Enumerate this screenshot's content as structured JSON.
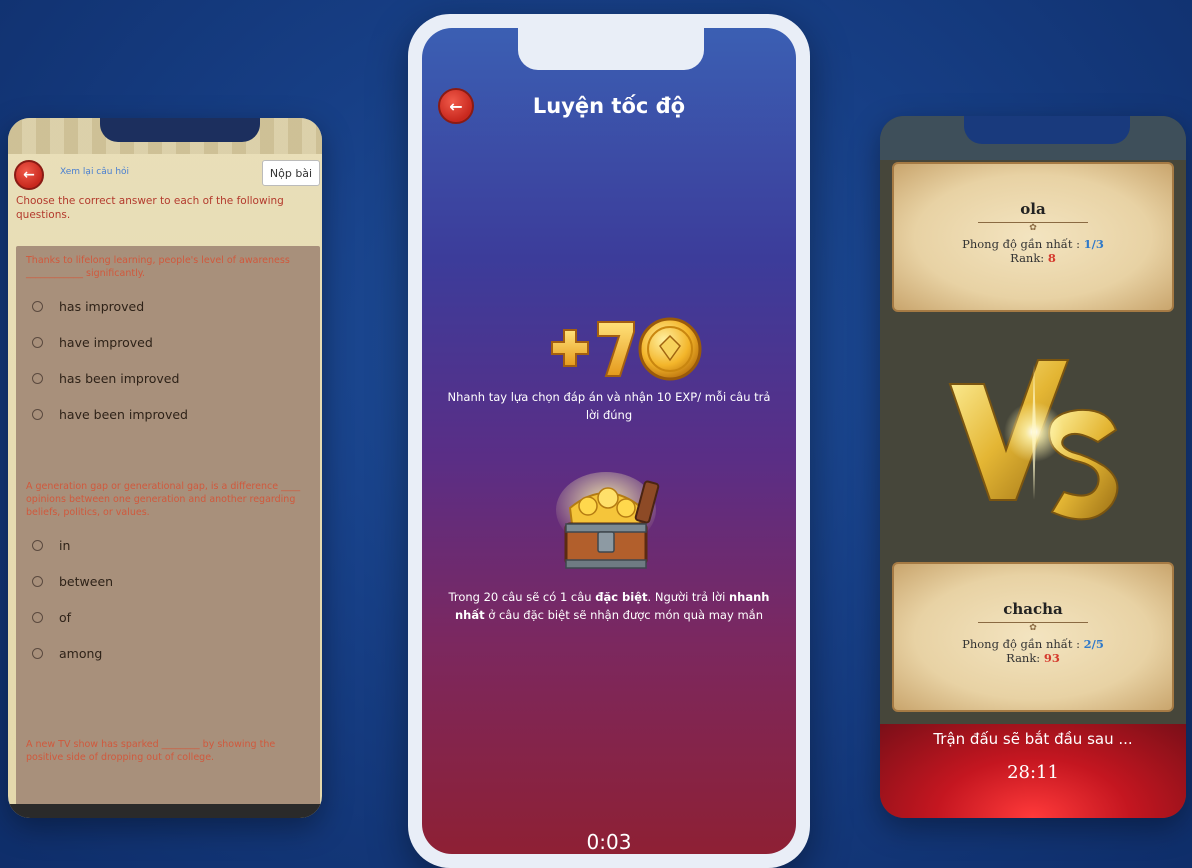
{
  "left_screen": {
    "review_link": "Xem lại câu hỏi",
    "submit_label": "Nộp bài",
    "instruction": "Choose the correct answer to each of the following questions.",
    "questions": [
      {
        "text": "Thanks to lifelong learning, people's level of awareness ____________ significantly.",
        "options": [
          "has improved",
          "have improved",
          "has been improved",
          "have been improved"
        ]
      },
      {
        "text": "A generation gap or generational gap, is a difference ____ opinions between one generation and another regarding beliefs, politics, or values.",
        "options": [
          "in",
          "between",
          "of",
          "among"
        ]
      },
      {
        "text": "A new TV show has sparked ________ by showing the positive side of dropping out of college."
      }
    ]
  },
  "center_screen": {
    "title": "Luyện tốc độ",
    "reward_line": "Nhanh tay lựa chọn đáp án và nhận 10 EXP/ mỗi câu trả lời đúng",
    "special_intro": "Trong 20 câu sẽ có 1 câu ",
    "special_bold1": "đặc biệt",
    "special_mid": ". Người trả lời ",
    "special_bold2": "nhanh nhất",
    "special_end": " ở câu đặc biệt sẽ nhận được món quà may mắn",
    "timer": "0:03"
  },
  "right_screen": {
    "players": [
      {
        "name": "ola",
        "form_label": "Phong độ gần nhất : ",
        "form_value": "1/3",
        "rank_label": "Rank: ",
        "rank_value": "8"
      },
      {
        "name": "chacha",
        "form_label": "Phong độ gần nhất : ",
        "form_value": "2/5",
        "rank_label": "Rank: ",
        "rank_value": "93"
      }
    ],
    "start_text": "Trận đấu sẽ bắt đầu sau ...",
    "countdown": "28:11"
  },
  "colors": {
    "background": "#173f86",
    "accent_red": "#c8281e",
    "form_blue": "#2f79c9",
    "rank_red": "#d53a2d"
  },
  "icons": [
    "back-arrow-icon",
    "radio-icon",
    "plus-ten-badge-icon",
    "treasure-chest-icon",
    "vs-emblem-icon"
  ]
}
